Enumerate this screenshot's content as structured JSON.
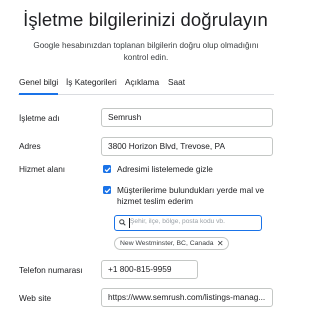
{
  "header": {
    "title": "İşletme bilgilerinizi doğrulayın",
    "subtitle": "Google hesabınızdan toplanan bilgilerin doğru olup olmadığını kontrol edin."
  },
  "tabs": [
    {
      "label": "Genel bilgi",
      "active": true
    },
    {
      "label": "İş Kategorileri",
      "active": false
    },
    {
      "label": "Açıklama",
      "active": false
    },
    {
      "label": "Saat",
      "active": false
    }
  ],
  "form": {
    "business_name": {
      "label": "İşletme adı",
      "value": "Semrush"
    },
    "address": {
      "label": "Adres",
      "value": "3800 Horizon Blvd, Trevose, PA"
    },
    "service_area": {
      "label": "Hizmet alanı",
      "hide_address": {
        "label": "Adresimi listelemede gizle",
        "checked": true
      },
      "serve_customers": {
        "label_line1": "Müşterilerime bulundukları yerde mal ve",
        "label_line2": "hizmet teslim ederim",
        "checked": true
      },
      "search": {
        "placeholder": "Şehir, ilçe, bölge, posta kodu vb.",
        "icon": "search-icon"
      },
      "chips": [
        {
          "label": "New Westminster, BC, Canada"
        }
      ]
    },
    "phone": {
      "label": "Telefon numarası",
      "value": "+1 800-815-9959"
    },
    "website": {
      "label": "Web site",
      "value": "https://www.semrush.com/listings-manag..."
    }
  },
  "colors": {
    "accent": "#1a73e8",
    "border": "#c4c7c5",
    "text": "#202124"
  }
}
